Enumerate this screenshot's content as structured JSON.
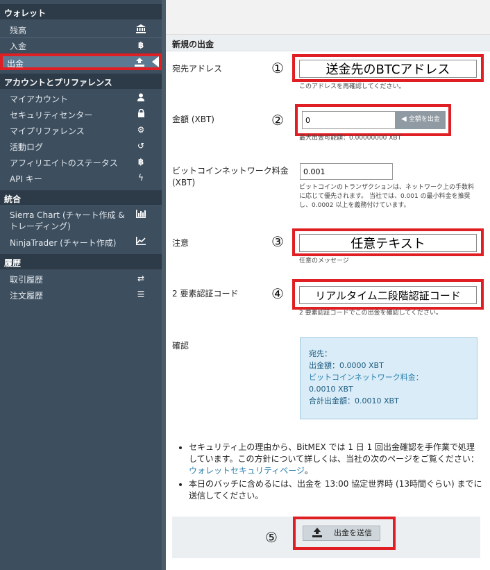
{
  "sidebar": {
    "wallet_header": "ウォレット",
    "wallet_items": [
      {
        "label": "残高",
        "icon": "bank-icon"
      },
      {
        "label": "入金",
        "icon": "bitcoin-icon"
      },
      {
        "label": "出金",
        "icon": "upload-icon"
      }
    ],
    "account_header": "アカウントとプリファレンス",
    "account_items": [
      {
        "label": "マイアカウント",
        "icon": "user-icon"
      },
      {
        "label": "セキュリティセンター",
        "icon": "lock-icon"
      },
      {
        "label": "マイプリファレンス",
        "icon": "gear-icon"
      },
      {
        "label": "活動ログ",
        "icon": "history-icon"
      },
      {
        "label": "アフィリエイトのステータス",
        "icon": "bitcoin-icon"
      },
      {
        "label": "API キー",
        "icon": "bolt-icon"
      }
    ],
    "integration_header": "統合",
    "integration_items": [
      {
        "label": "Sierra Chart (チャート作成 & トレーディング)",
        "icon": "bar-chart-icon"
      },
      {
        "label": "NinjaTrader (チャート作成)",
        "icon": "line-chart-icon"
      }
    ],
    "history_header": "履歴",
    "history_items": [
      {
        "label": "取引履歴",
        "icon": "exchange-icon"
      },
      {
        "label": "注文履歴",
        "icon": "list-icon"
      }
    ]
  },
  "form": {
    "title": "新規の出金",
    "address": {
      "label": "宛先アドレス",
      "marker": "①",
      "value": "送金先のBTCアドレス",
      "help": "このアドレスを再確認してください。"
    },
    "amount": {
      "label": "金額 (XBT)",
      "marker": "②",
      "value": "0",
      "max_button": "全額を出金",
      "help": "最大出金可能額：0.00000000 XBT"
    },
    "fee": {
      "label": "ビットコインネットワーク料金 (XBT)",
      "value": "0.001",
      "help": "ビットコインのトランザクションは、ネットワーク上の手数料に応じて優先されます。 当社では、0.001 の最小料金を推奨し、0.0002 以上を義務付けています。"
    },
    "note": {
      "label": "注意",
      "marker": "③",
      "value": "任意テキスト",
      "help": "任意のメッセージ"
    },
    "twofa": {
      "label": "2 要素認証コード",
      "marker": "④",
      "value": "リアルタイム二段階認証コード",
      "help": "2 要素認証コードでこの出金を確認してください。"
    },
    "confirm": {
      "label": "確認",
      "dest": "宛先：",
      "amount_line": "出金額：0.0000 XBT",
      "fee_label": "ビットコインネットワーク料金：",
      "fee_value": "0.0010 XBT",
      "total_line": "合計出金額：0.0010 XBT"
    },
    "notes": {
      "n1_pre": "セキュリティ上の理由から、BitMEX では 1 日 1 回出金確認を手作業で処理しています。この方針について詳しくは、当社の次のページをご覧ください：",
      "n1_link": "ウォレットセキュリティページ",
      "n1_post": "。",
      "n2": "本日のバッチに含めるには、出金を 13:00 協定世界時 (13時間ぐらい) までに送信してください。"
    },
    "submit": {
      "marker": "⑤",
      "label": "出金を送信"
    }
  }
}
